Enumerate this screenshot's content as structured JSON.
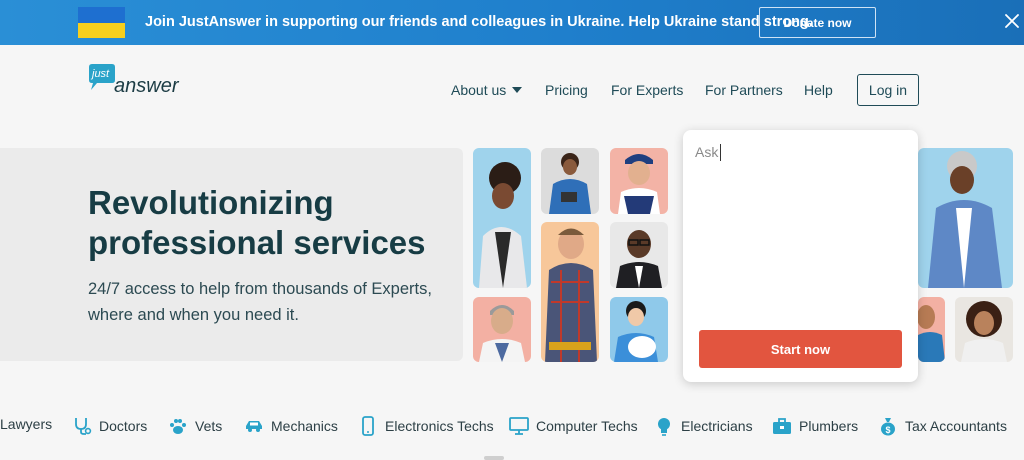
{
  "banner": {
    "text": "Join JustAnswer in supporting our friends and colleagues in Ukraine. Help Ukraine stand strong.",
    "donate_label": "Donate now",
    "flag_colors": [
      "#1e6fd0",
      "#f7cf1d"
    ]
  },
  "header": {
    "logo_top": "just",
    "logo_main": "answer",
    "nav": {
      "about": "About us",
      "pricing": "Pricing",
      "experts": "For Experts",
      "partners": "For Partners",
      "help": "Help"
    },
    "login_label": "Log in"
  },
  "hero": {
    "title": "Revolutionizing professional services",
    "subtitle": "24/7 access to help from thousands of Experts, where and when you need it."
  },
  "ask": {
    "placeholder": "Ask",
    "start_label": "Start now"
  },
  "categories": [
    {
      "label": "Lawyers",
      "icon": "scales-icon"
    },
    {
      "label": "Doctors",
      "icon": "stethoscope-icon"
    },
    {
      "label": "Vets",
      "icon": "paw-icon"
    },
    {
      "label": "Mechanics",
      "icon": "car-icon"
    },
    {
      "label": "Electronics Techs",
      "icon": "phone-icon"
    },
    {
      "label": "Computer Techs",
      "icon": "monitor-icon"
    },
    {
      "label": "Electricians",
      "icon": "lightbulb-icon"
    },
    {
      "label": "Plumbers",
      "icon": "toolbox-icon"
    },
    {
      "label": "Tax Accountants",
      "icon": "money-bag-icon"
    }
  ],
  "colors": {
    "accent": "#e2553f",
    "banner": "#1f7fcc",
    "text_dark": "#173c44",
    "icon": "#2aa3c9"
  }
}
